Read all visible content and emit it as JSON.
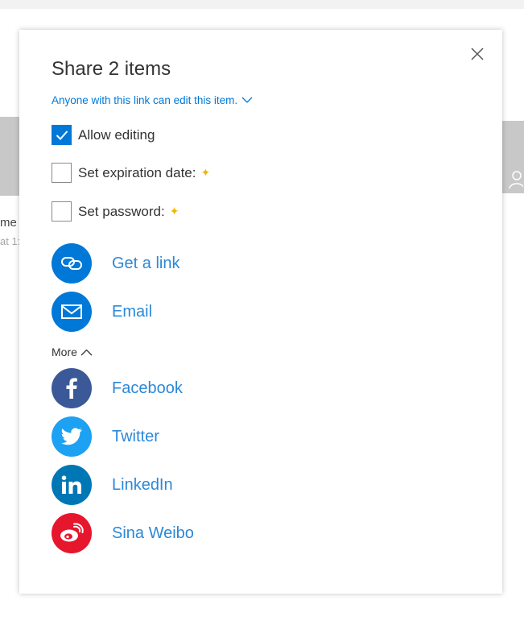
{
  "background": {
    "text_1": "me",
    "text_2": "at 1:"
  },
  "dialog": {
    "title": "Share 2 items",
    "link_scope": "Anyone with this link can edit this item.",
    "options": [
      {
        "label": "Allow editing",
        "checked": true,
        "premium": false
      },
      {
        "label": "Set expiration date:",
        "checked": false,
        "premium": true
      },
      {
        "label": "Set password:",
        "checked": false,
        "premium": true
      }
    ],
    "premium_glyph": "✦",
    "share_primary": [
      {
        "label": "Get a link",
        "icon": "link-icon",
        "color": "#0078d7"
      },
      {
        "label": "Email",
        "icon": "mail-icon",
        "color": "#0078d7"
      }
    ],
    "more_label": "More",
    "share_social": [
      {
        "label": "Facebook",
        "icon": "facebook-icon",
        "color": "#3b5998"
      },
      {
        "label": "Twitter",
        "icon": "twitter-icon",
        "color": "#1da1f2"
      },
      {
        "label": "LinkedIn",
        "icon": "linkedin-icon",
        "color": "#0077b5"
      },
      {
        "label": "Sina Weibo",
        "icon": "weibo-icon",
        "color": "#e6162d"
      }
    ]
  },
  "colors": {
    "accent": "#0078d7",
    "link_text": "#2b88d8",
    "premium_star": "#f2b600"
  }
}
